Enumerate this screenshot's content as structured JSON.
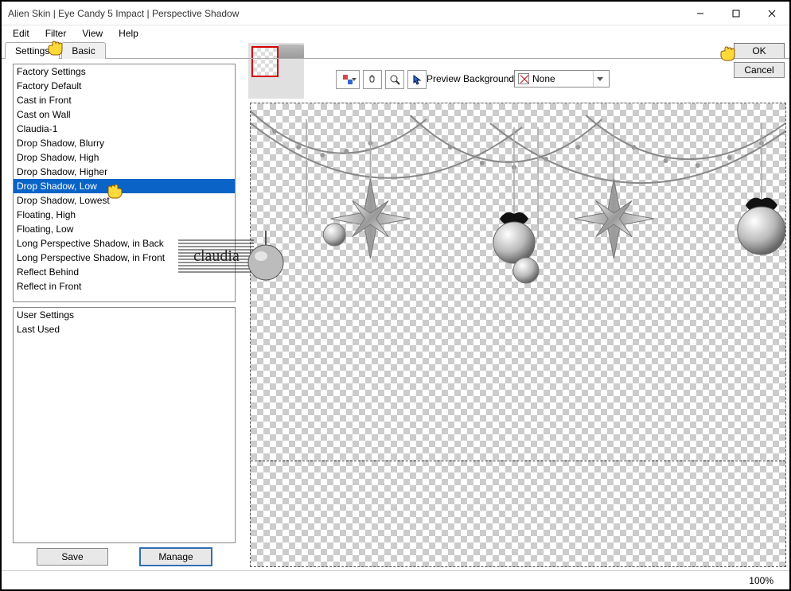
{
  "window": {
    "title": "Alien Skin | Eye Candy 5 Impact | Perspective Shadow"
  },
  "menu": {
    "items": [
      "Edit",
      "Filter",
      "View",
      "Help"
    ]
  },
  "tabs": {
    "settings": "Settings",
    "basic": "Basic",
    "active": "settings"
  },
  "dialog_buttons": {
    "ok": "OK",
    "cancel": "Cancel"
  },
  "factory_presets": {
    "items": [
      "Factory Settings",
      "Factory Default",
      "Cast in Front",
      "Cast on Wall",
      "Claudia-1",
      "Drop Shadow, Blurry",
      "Drop Shadow, High",
      "Drop Shadow, Higher",
      "Drop Shadow, Low",
      "Drop Shadow, Lowest",
      "Floating, High",
      "Floating, Low",
      "Long Perspective Shadow, in Back",
      "Long Perspective Shadow, in Front",
      "Reflect Behind",
      "Reflect in Front"
    ],
    "selected_index": 8
  },
  "user_presets": {
    "items": [
      "User Settings",
      "Last Used"
    ]
  },
  "panel_buttons": {
    "save": "Save",
    "manage": "Manage"
  },
  "toolbar": {
    "preview_bg_label": "Preview Background:",
    "preview_bg_value": "None"
  },
  "status": {
    "zoom": "100%"
  },
  "watermark": {
    "text": "claudia"
  },
  "icons": {
    "color_tool": "color",
    "hand_tool": "hand",
    "zoom_tool": "zoom",
    "pointer_tool": "pointer"
  }
}
